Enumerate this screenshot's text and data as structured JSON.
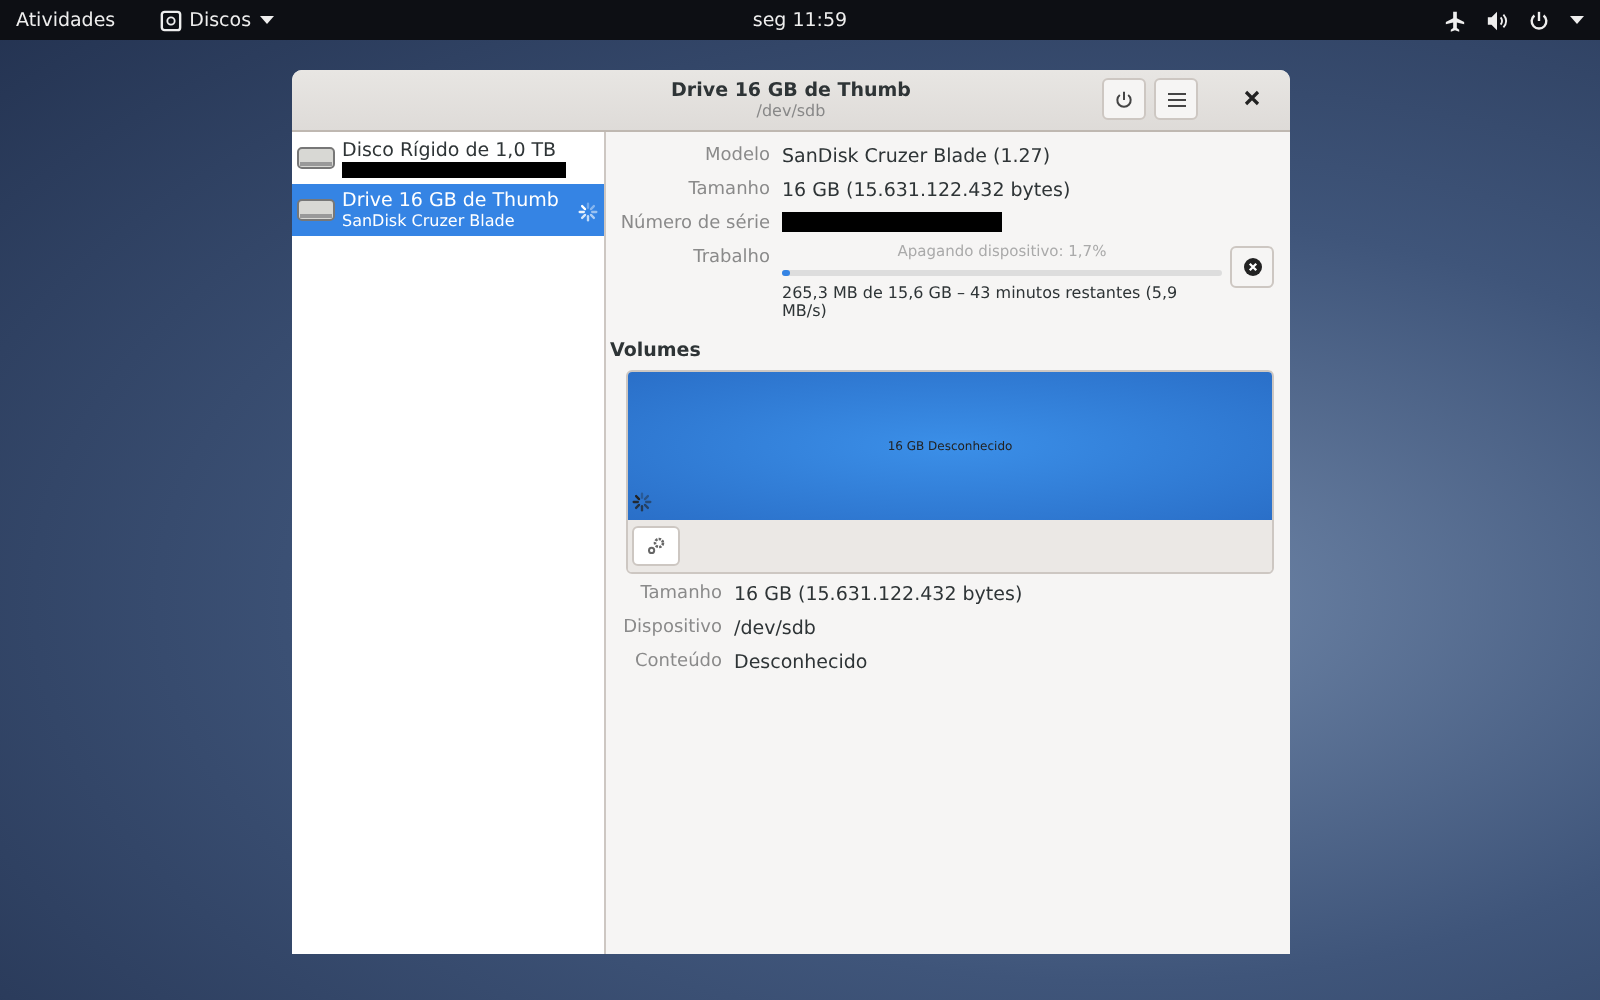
{
  "top_bar": {
    "activities": "Atividades",
    "app_menu": "Discos",
    "clock": "seg 11:59"
  },
  "window": {
    "title": "Drive 16 GB de Thumb",
    "subtitle": "/dev/sdb"
  },
  "sidebar": {
    "items": [
      {
        "name": "Disco Rígido de 1,0 TB",
        "subtitle_redacted": true,
        "selected": false,
        "busy": false
      },
      {
        "name": "Drive 16 GB de Thumb",
        "subtitle": "SanDisk Cruzer Blade",
        "selected": true,
        "busy": true
      }
    ]
  },
  "drive": {
    "rows": [
      {
        "label": "Modelo",
        "value": "SanDisk Cruzer Blade (1.27)"
      },
      {
        "label": "Tamanho",
        "value": "16 GB (15.631.122.432 bytes)"
      },
      {
        "label": "Número de série",
        "redacted": true
      }
    ],
    "job": {
      "label": "Trabalho",
      "status": "Apagando dispositivo: 1,7%",
      "level": 0.017,
      "detail": "265,3 MB de 15,6 GB – 43 minutos restantes (5,9 MB/s)"
    }
  },
  "volumes": {
    "heading": "Volumes",
    "partition": {
      "label": "16 GB Desconhecido",
      "busy": true
    },
    "rows": [
      {
        "label": "Tamanho",
        "value": "16 GB (15.631.122.432 bytes)"
      },
      {
        "label": "Dispositivo",
        "value": "/dev/sdb"
      },
      {
        "label": "Conteúdo",
        "value": "Desconhecido"
      }
    ]
  }
}
